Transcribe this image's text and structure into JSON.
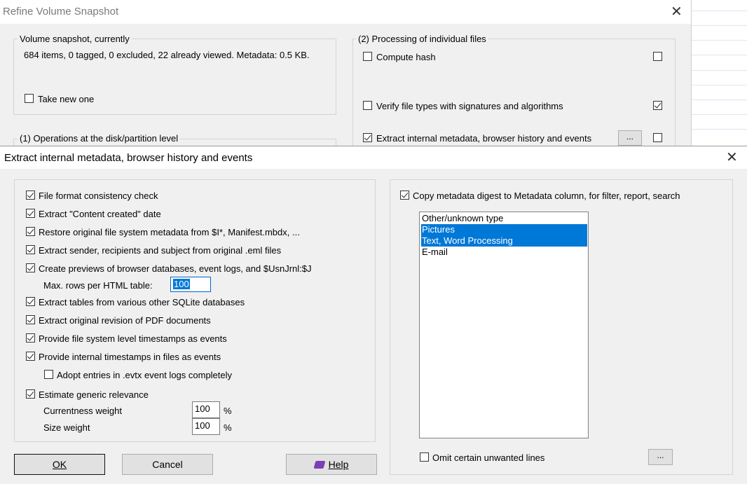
{
  "bg_window": {
    "title": "Refine Volume Snapshot",
    "group_snapshot_label": "Volume snapshot, currently",
    "snapshot_info": "684 items, 0 tagged, 0 excluded, 22 already viewed. Metadata: 0.5 KB.",
    "take_new_label": "Take new one",
    "group_disk_label": "(1) Operations at the disk/partition level",
    "group_processing_label": "(2) Processing of individual files",
    "compute_hash_label": "Compute hash",
    "verify_label": "Verify file types with signatures and algorithms",
    "extract_meta_label": "Extract internal metadata, browser history and events",
    "dots": "..."
  },
  "dialog": {
    "title": "Extract internal metadata, browser history and events",
    "options": {
      "file_format": "File format consistency check",
      "content_created": "Extract \"Content created\" date",
      "restore_fs": "Restore original file system metadata from $I*, Manifest.mbdx, ...",
      "eml": "Extract sender, recipients and subject from original .eml files",
      "previews": "Create previews of browser databases, event logs, and $UsnJrnl:$J",
      "max_rows_label": "Max. rows per HTML table:",
      "max_rows_value": "100",
      "sqlite": "Extract tables from various other SQLite databases",
      "pdf": "Extract original revision of PDF documents",
      "fs_timestamps": "Provide file system level timestamps as events",
      "internal_timestamps": "Provide internal timestamps in files as events",
      "evtx": "Adopt entries in .evtx event logs completely",
      "relevance": "Estimate generic relevance",
      "currentness_label": "Currentness weight",
      "currentness_value": "100",
      "size_label": "Size weight",
      "size_value": "100",
      "percent": "%"
    },
    "copy_digest": "Copy metadata digest to Metadata column, for filter, report, search",
    "types": [
      "Other/unknown type",
      "Pictures",
      "Text, Word Processing",
      "E-mail"
    ],
    "omit_label": "Omit certain unwanted lines",
    "dots": "...",
    "ok": "OK",
    "cancel": "Cancel",
    "help": "Help"
  }
}
